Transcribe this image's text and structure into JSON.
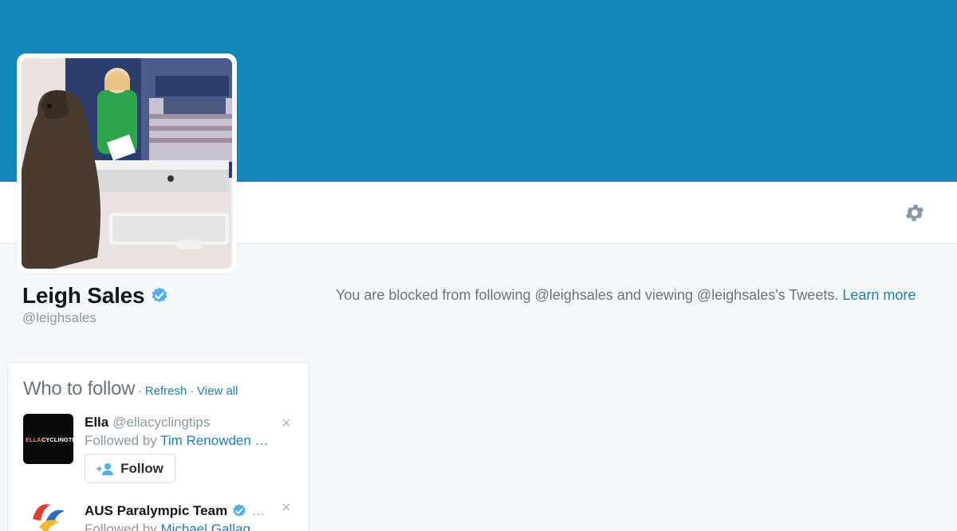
{
  "profile": {
    "name": "Leigh Sales",
    "handle": "@leighsales"
  },
  "blocked": {
    "message": "You are blocked from following @leighsales and viewing @leighsales's Tweets.",
    "learn_more": "Learn more"
  },
  "who_to_follow": {
    "title": "Who to follow",
    "separator": "·",
    "refresh": "Refresh",
    "view_all": "View all",
    "accounts": [
      {
        "name": "Ella",
        "handle": "@ellacyclingtips",
        "followed_by_label": "Followed by",
        "followed_by_user": "Tim Renowden …",
        "follow_label": "Follow",
        "avatar_text_1": "ELLA",
        "avatar_text_2": "CYCLINGTIPS"
      },
      {
        "name": "AUS Paralympic Team",
        "ellipsis": "…",
        "followed_by_label": "Followed by",
        "followed_by_user": "Michael Gallag"
      }
    ],
    "close_glyph": "×"
  },
  "colors": {
    "banner": "#1487b8",
    "link": "#1b7fb5",
    "verified": "#55acee"
  },
  "icons": {
    "settings": "gear-icon",
    "verified": "verified-badge-icon",
    "close": "close-icon",
    "follow": "add-user-icon"
  }
}
